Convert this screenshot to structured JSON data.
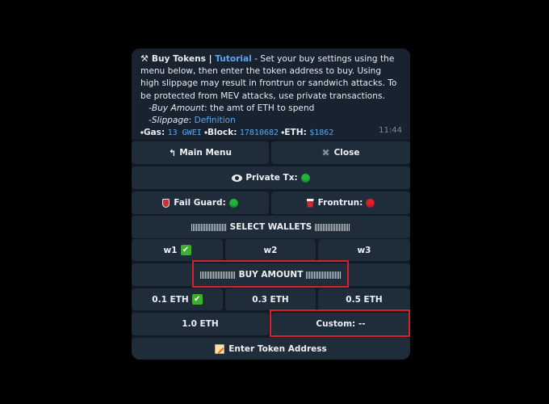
{
  "message": {
    "title": "Buy Tokens",
    "sep": " | ",
    "tutorial": "Tutorial",
    "body": " - Set your buy settings using the menu below, then enter the token address to buy. Using high slippage may result in frontrun or sandwich attacks. To be protected from MEV attacks, use private transactions.",
    "buy_amount_label": "Buy Amount",
    "buy_amount_desc": ": the amt of ETH to spend",
    "slippage_label": "Slippage",
    "slippage_sep": ": ",
    "definition": "Definition",
    "gas_label": "Gas:",
    "gas_value": "13 GWEI",
    "block_label": "Block:",
    "block_value": "17810682",
    "eth_label": "ETH:",
    "eth_value": "$1862",
    "time": "11:44"
  },
  "buttons": {
    "main_menu": "Main Menu",
    "close": "Close",
    "private_tx": "Private Tx:",
    "fail_guard": "Fail Guard:",
    "frontrun": "Frontrun:",
    "select_wallets": "SELECT WALLETS",
    "w1": "w1",
    "w2": "w2",
    "w3": "w3",
    "buy_amount": "BUY AMOUNT",
    "eth_01": "0.1 ETH",
    "eth_03": "0.3 ETH",
    "eth_05": "0.5 ETH",
    "eth_10": "1.0 ETH",
    "custom": "Custom: --",
    "enter_token": "Enter Token Address"
  },
  "colors": {
    "link": "#5aa6ee",
    "on": "#22b33a",
    "off": "#e0202a",
    "highlight": "#d8202a"
  }
}
